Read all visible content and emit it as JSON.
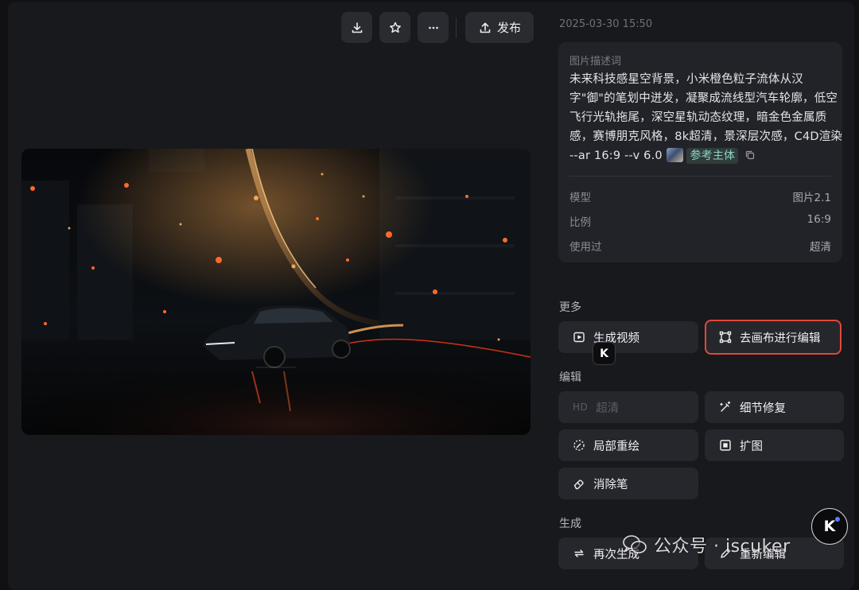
{
  "toolbar": {
    "download_icon": "download-icon",
    "favorite_icon": "star-icon",
    "more_icon": "more-icon",
    "publish_label": "发布"
  },
  "timestamp": "2025-03-30 15:50",
  "prompt": {
    "label": "图片描述词",
    "lines": [
      "未来科技感星空背景，小米橙色粒子流体从汉",
      "字\"御\"的笔划中迸发，凝聚成流线型汽车轮廓，低空",
      "飞行光轨拖尾，深空星轨动态纹理，暗金色金属质",
      "感，赛博朋克风格，8k超清，景深层次感，C4D渲染"
    ],
    "params": "--ar 16:9 --v 6.0",
    "ref_label": "参考主体"
  },
  "meta": {
    "model_label": "模型",
    "model_value": "图片2.1",
    "ratio_label": "比例",
    "ratio_value": "16:9",
    "used_label": "使用过",
    "used_value": "超清"
  },
  "sections": {
    "more": "更多",
    "edit": "编辑",
    "generate": "生成"
  },
  "actions": {
    "gen_video": "生成视频",
    "canvas_edit": "去画布进行编辑",
    "hd_tag": "HD",
    "hd": "超清",
    "detail_fix": "细节修复",
    "inpaint": "局部重绘",
    "expand": "扩图",
    "eraser": "消除笔",
    "regenerate": "再次生成",
    "reedit": "重新编辑"
  },
  "badges": {
    "k_small": "K",
    "k_float": "K"
  },
  "watermark": "公众号 · iscuker",
  "colors": {
    "background": "#18191d",
    "card": "#222328",
    "button": "#26272c",
    "highlight_border": "#e0483a",
    "accent_orange": "#ff7a2a"
  }
}
